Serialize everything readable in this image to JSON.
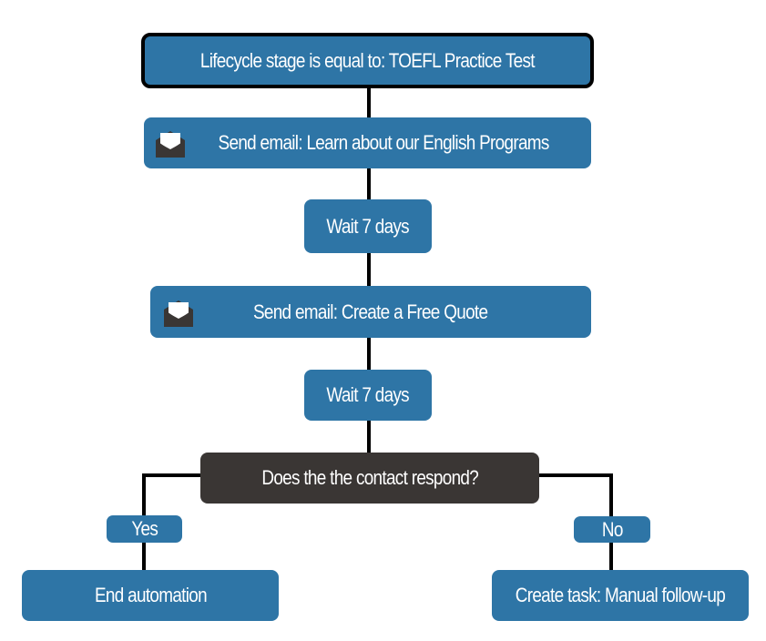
{
  "diagram": {
    "type": "workflow-flowchart",
    "colors": {
      "node_fill": "#2e75a6",
      "decision_fill": "#3a3634",
      "connector": "#000000",
      "text": "#ffffff"
    },
    "trigger": {
      "label": "Lifecycle stage is equal to: TOEFL Practice Test"
    },
    "steps": [
      {
        "type": "email",
        "icon": "open-envelope-icon",
        "label": "Send email: Learn about our English Programs"
      },
      {
        "type": "delay",
        "label": "Wait 7 days"
      },
      {
        "type": "email",
        "icon": "open-envelope-icon",
        "label": "Send email: Create a Free Quote"
      },
      {
        "type": "delay",
        "label": "Wait 7 days"
      }
    ],
    "decision": {
      "label": "Does the the contact respond?",
      "branches": [
        {
          "label": "Yes",
          "action": "End automation"
        },
        {
          "label": "No",
          "action": "Create task: Manual follow-up"
        }
      ]
    }
  }
}
